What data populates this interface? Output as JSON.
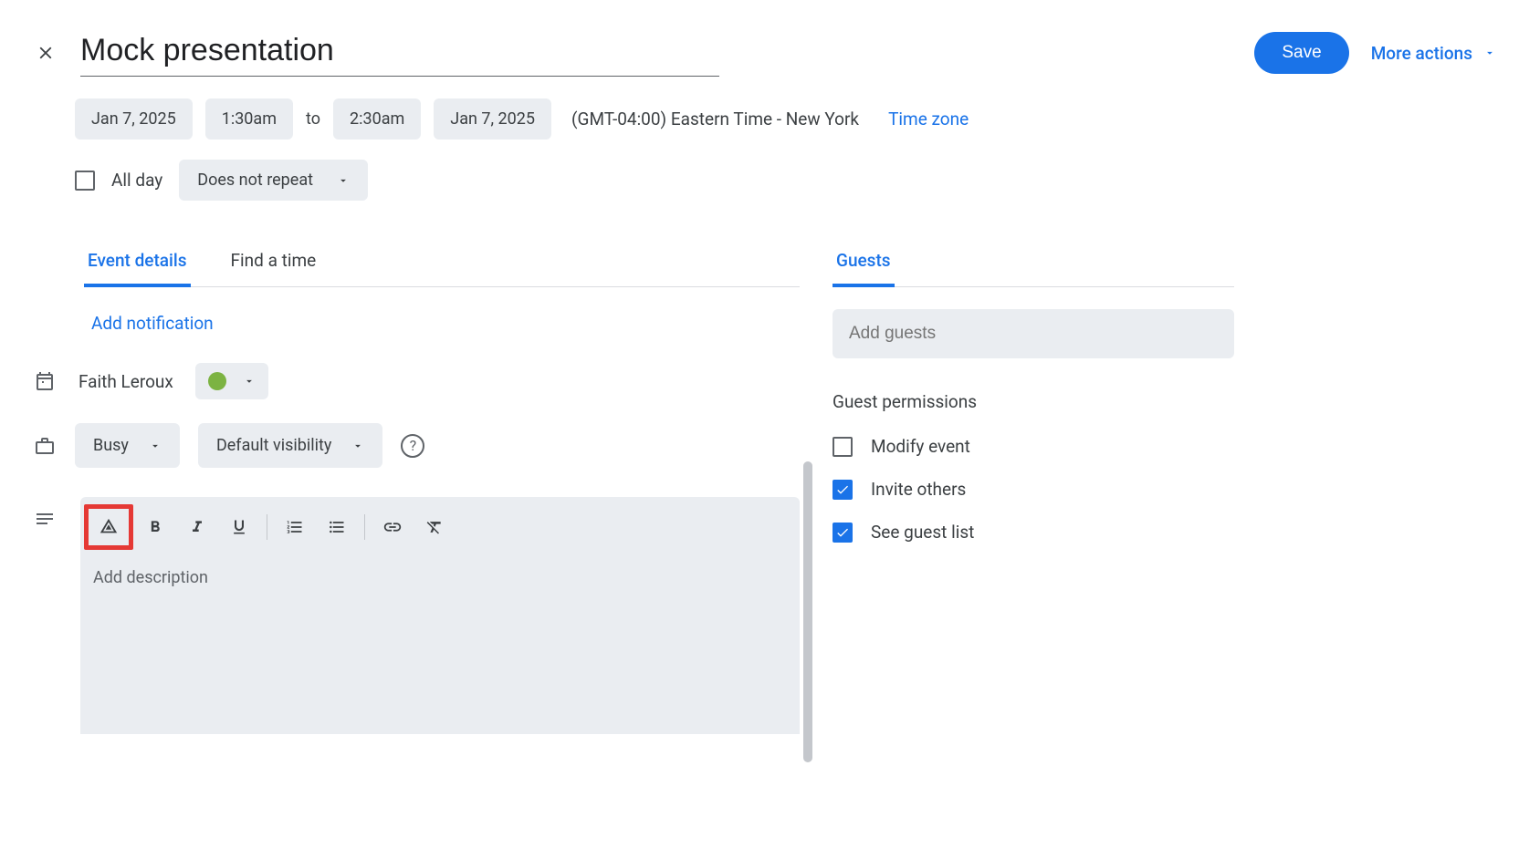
{
  "header": {
    "title": "Mock presentation",
    "save_label": "Save",
    "more_actions_label": "More actions"
  },
  "datetime": {
    "start_date": "Jan 7, 2025",
    "start_time": "1:30am",
    "to_label": "to",
    "end_time": "2:30am",
    "end_date": "Jan 7, 2025",
    "tz_display": "(GMT-04:00) Eastern Time - New York",
    "tz_link": "Time zone"
  },
  "allday": {
    "label": "All day",
    "checked": false
  },
  "repeat": {
    "label": "Does not repeat"
  },
  "tabs": {
    "event_details": "Event details",
    "find_time": "Find a time",
    "guests": "Guests"
  },
  "notification": {
    "add_label": "Add notification"
  },
  "calendar": {
    "owner": "Faith Leroux",
    "color": "#7cb342"
  },
  "availability": {
    "busy_label": "Busy",
    "visibility_label": "Default visibility"
  },
  "description": {
    "placeholder": "Add description"
  },
  "guests_panel": {
    "add_placeholder": "Add guests",
    "perm_title": "Guest permissions",
    "perm_modify": "Modify event",
    "perm_invite": "Invite others",
    "perm_seelist": "See guest list",
    "perm_modify_checked": false,
    "perm_invite_checked": true,
    "perm_seelist_checked": true
  }
}
